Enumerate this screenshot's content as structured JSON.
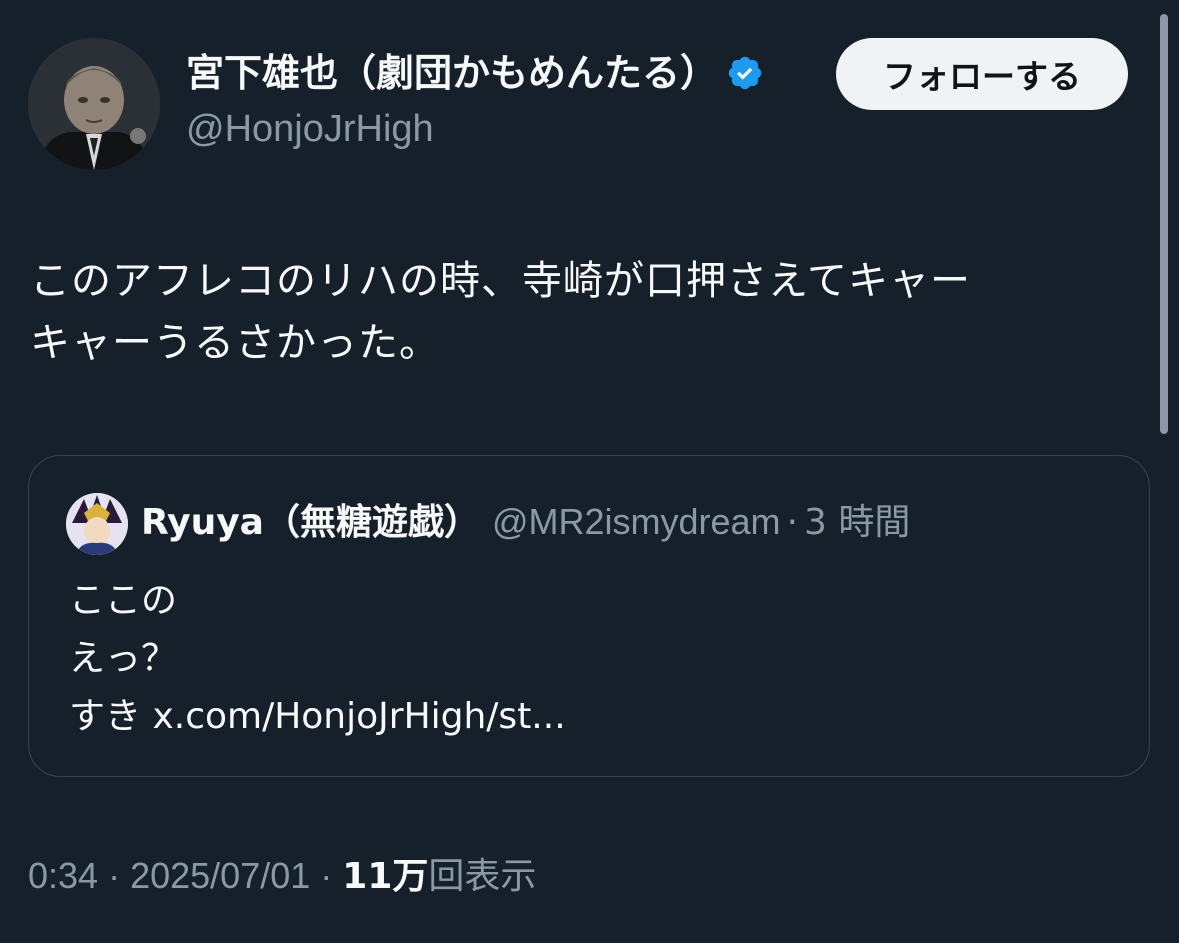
{
  "author": {
    "display_name": "宮下雄也（劇団かもめんたる）",
    "handle": "@HonjoJrHigh",
    "verified_icon": "verified-badge-icon",
    "avatar_icon": "profile-photo"
  },
  "follow_button": {
    "label": "フォローする"
  },
  "tweet": {
    "text_lines": [
      "このアフレコのリハの時、寺崎が口押さえてキャー",
      "キャーうるさかった。"
    ]
  },
  "quoted_tweet": {
    "display_name": "Ryuya（無糖遊戯）",
    "handle": "@MR2ismydream",
    "separator": "·",
    "time": "3 時間",
    "body_lines": [
      "ここの",
      "えっ？",
      "すき x.com/HonjoJrHigh/st..."
    ]
  },
  "meta": {
    "time": "0:34",
    "sep1": " · ",
    "date": "2025/07/01",
    "sep2": " · ",
    "views_count": "11万",
    "views_label": "回表示"
  },
  "colors": {
    "background": "#15202b",
    "text_primary": "#f7f9f9",
    "text_secondary": "#8b98a5",
    "verified": "#1d9bf0",
    "border": "#38444d"
  }
}
